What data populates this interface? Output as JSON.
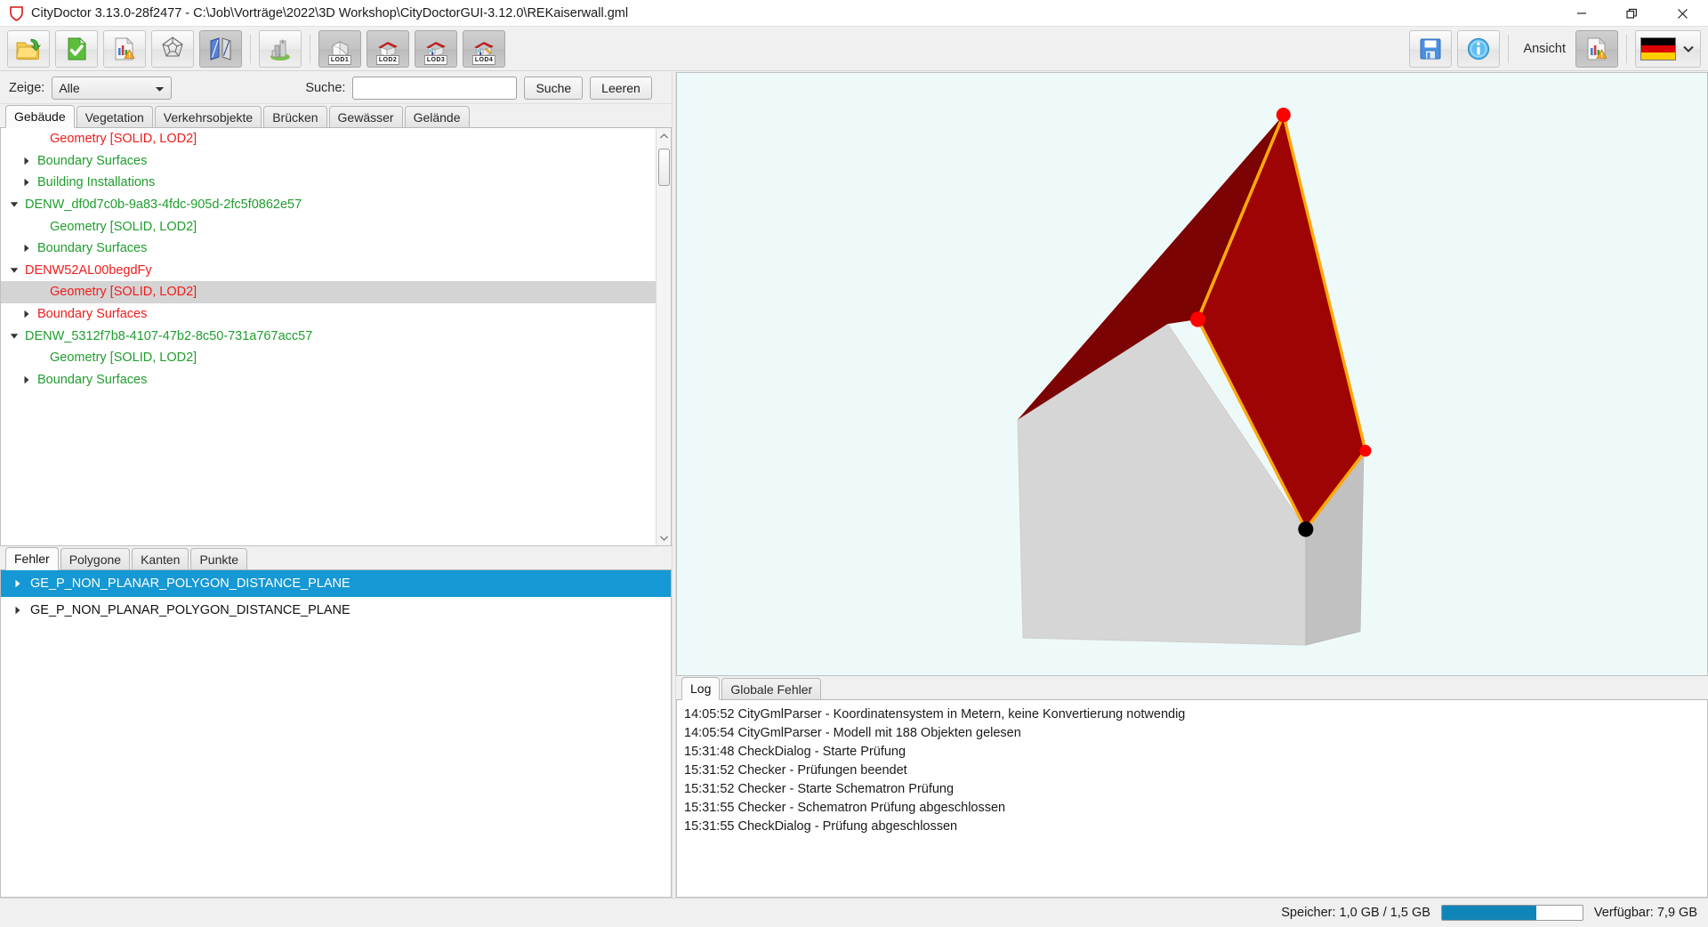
{
  "window": {
    "title": "CityDoctor 3.13.0-28f2477 - C:\\Job\\Vorträge\\2022\\3D Workshop\\CityDoctorGUI-3.12.0\\REKaiserwall.gml",
    "logo_icon": "shield-logo-icon",
    "minimize_label": "—",
    "maximize_label": "❐",
    "close_label": "✕"
  },
  "toolbar": {
    "buttons": [
      {
        "name": "open-file-button",
        "icon": "folder-open-icon",
        "pressed": false
      },
      {
        "name": "validate-button",
        "icon": "green-check-document-icon",
        "pressed": false
      },
      {
        "name": "report-button",
        "icon": "report-warning-icon",
        "pressed": false
      },
      {
        "name": "polyhedron-button",
        "icon": "polyhedron-icon",
        "pressed": false
      },
      {
        "name": "planes-button",
        "icon": "blue-planes-icon",
        "pressed": true
      },
      {
        "name": "city-model-button",
        "icon": "city-buildings-icon",
        "pressed": false
      }
    ],
    "lod_buttons": [
      {
        "name": "lod1-button",
        "label": "LOD1",
        "icon": "box-lod1-icon",
        "pressed": true
      },
      {
        "name": "lod2-button",
        "label": "LOD2",
        "icon": "house-lod2-icon",
        "pressed": true
      },
      {
        "name": "lod3-button",
        "label": "LOD3",
        "icon": "house-lod3-icon",
        "pressed": true
      },
      {
        "name": "lod4-button",
        "label": "LOD4",
        "icon": "house-lod4-icon",
        "pressed": true
      }
    ],
    "save_button": {
      "name": "save-button",
      "icon": "floppy-save-icon"
    },
    "info_button": {
      "name": "info-button",
      "icon": "info-circle-icon"
    },
    "ansicht_label": "Ansicht",
    "ansicht_button": {
      "name": "ansicht-report-button",
      "icon": "report-warning-icon"
    },
    "language_flag": "german-flag-icon",
    "language_caret": "chevron-down-icon"
  },
  "filter": {
    "zeige_label": "Zeige:",
    "zeige_value": "Alle",
    "zeige_caret": "chevron-down-icon",
    "suche_label": "Suche:",
    "suche_value": "",
    "suche_placeholder": "",
    "search_button": "Suche",
    "clear_button": "Leeren"
  },
  "feature_tabs": [
    {
      "label": "Gebäude",
      "active": true
    },
    {
      "label": "Vegetation",
      "active": false
    },
    {
      "label": "Verkehrsobjekte",
      "active": false
    },
    {
      "label": "Brücken",
      "active": false
    },
    {
      "label": "Gewässer",
      "active": false
    },
    {
      "label": "Gelände",
      "active": false
    }
  ],
  "tree": {
    "rows": [
      {
        "label": "Geometry [SOLID, LOD2]",
        "color": "red",
        "indent": 50,
        "arrow": "none",
        "selected": false
      },
      {
        "label": "Boundary Surfaces",
        "color": "green",
        "indent": 36,
        "arrow": "collapsed",
        "selected": false
      },
      {
        "label": "Building Installations",
        "color": "green",
        "indent": 36,
        "arrow": "collapsed",
        "selected": false
      },
      {
        "label": "DENW_df0d7c0b-9a83-4fdc-905d-2fc5f0862e57",
        "color": "green",
        "indent": 22,
        "arrow": "expanded",
        "selected": false
      },
      {
        "label": "Geometry [SOLID, LOD2]",
        "color": "green",
        "indent": 50,
        "arrow": "none",
        "selected": false
      },
      {
        "label": "Boundary Surfaces",
        "color": "green",
        "indent": 36,
        "arrow": "collapsed",
        "selected": false
      },
      {
        "label": "DENW52AL00begdFy",
        "color": "red",
        "indent": 22,
        "arrow": "expanded",
        "selected": false
      },
      {
        "label": "Geometry [SOLID, LOD2]",
        "color": "red",
        "indent": 50,
        "arrow": "none",
        "selected": true
      },
      {
        "label": "Boundary Surfaces",
        "color": "red",
        "indent": 36,
        "arrow": "collapsed",
        "selected": false
      },
      {
        "label": "DENW_5312f7b8-4107-47b2-8c50-731a767acc57",
        "color": "green",
        "indent": 22,
        "arrow": "expanded",
        "selected": false
      },
      {
        "label": "Geometry [SOLID, LOD2]",
        "color": "green",
        "indent": 50,
        "arrow": "none",
        "selected": false
      },
      {
        "label": "Boundary Surfaces",
        "color": "green",
        "indent": 36,
        "arrow": "collapsed",
        "selected": false
      }
    ],
    "scroll_up_icon": "chevron-up-icon",
    "scroll_down_icon": "chevron-down-icon"
  },
  "error_tabs": [
    {
      "label": "Fehler",
      "active": true
    },
    {
      "label": "Polygone",
      "active": false
    },
    {
      "label": "Kanten",
      "active": false
    },
    {
      "label": "Punkte",
      "active": false
    }
  ],
  "errors": [
    {
      "label": "GE_P_NON_PLANAR_POLYGON_DISTANCE_PLANE",
      "selected": true
    },
    {
      "label": "GE_P_NON_PLANAR_POLYGON_DISTANCE_PLANE",
      "selected": false
    }
  ],
  "viewport": {
    "background_color": "#eefaf9",
    "wall_color": "#d6d6d6",
    "wall_side_color": "#c2c2c2",
    "roof_color": "#9e0404",
    "roof_dark_color": "#7d0303",
    "highlight_edge_color": "#ffa80a",
    "vertex_error_color": "#ff0000",
    "vertex_normal_color": "#000000"
  },
  "log_tabs": [
    {
      "label": "Log",
      "active": true
    },
    {
      "label": "Globale Fehler",
      "active": false
    }
  ],
  "log_lines": [
    "14:05:52 CityGmlParser - Koordinatensystem in Metern, keine Konvertierung notwendig",
    "14:05:54 CityGmlParser - Modell mit 188 Objekten gelesen",
    "15:31:48 CheckDialog - Starte Prüfung",
    "15:31:52 Checker - Prüfungen beendet",
    "15:31:52 Checker - Starte Schematron Prüfung",
    "15:31:55 Checker - Schematron Prüfung abgeschlossen",
    "15:31:55 CheckDialog - Prüfung abgeschlossen"
  ],
  "statusbar": {
    "memory_text": "Speicher: 1,0 GB / 1,5 GB",
    "memory_percent": 67,
    "memory_bar_color": "#1086b8",
    "available_text": "Verfügbar: 7,9 GB"
  }
}
